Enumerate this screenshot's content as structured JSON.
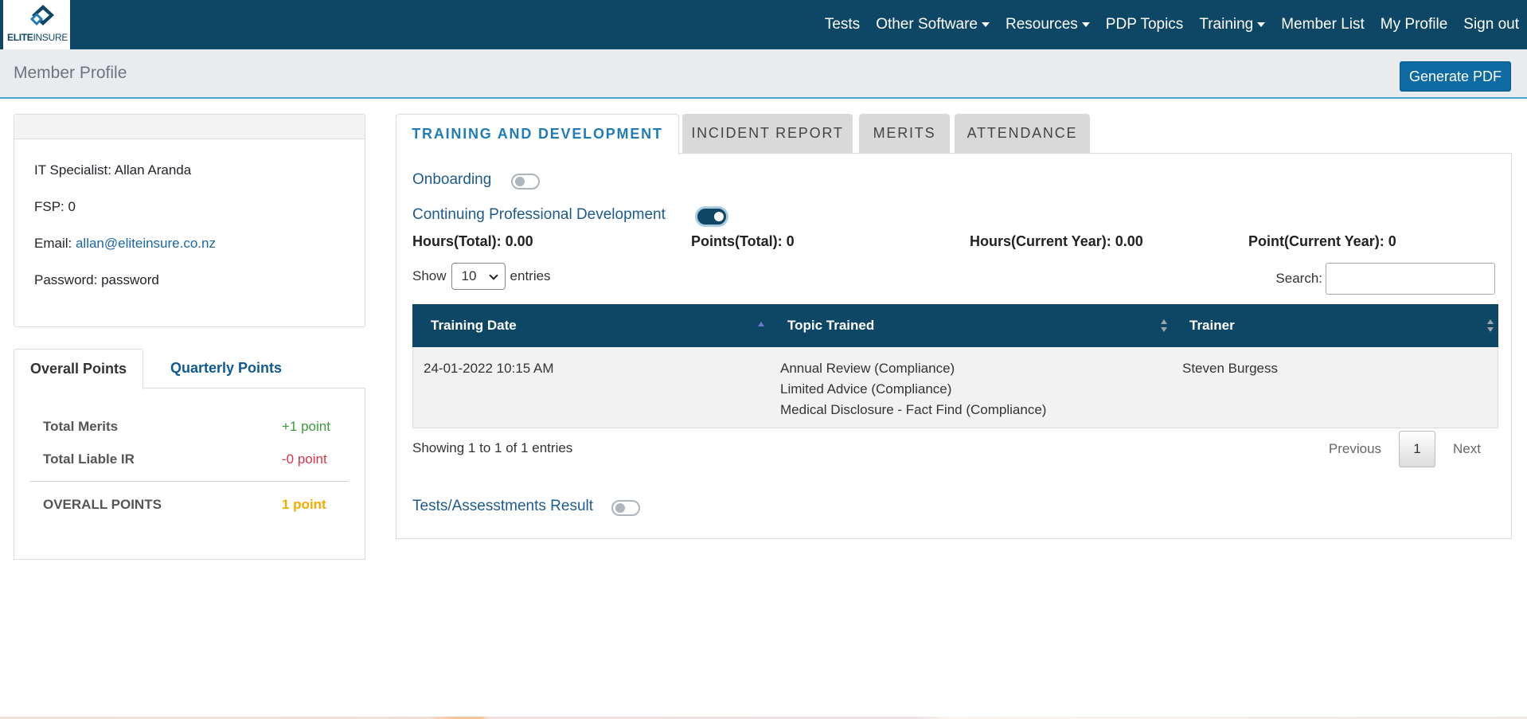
{
  "brand": {
    "logo_bold": "ELITE",
    "logo_light": "INSURE",
    "primary_color": "#0e4766",
    "accent_color": "#1f7cb8"
  },
  "nav": {
    "items": [
      {
        "label": "Tests",
        "dropdown": false
      },
      {
        "label": "Other Software",
        "dropdown": true
      },
      {
        "label": "Resources",
        "dropdown": true
      },
      {
        "label": "PDP Topics",
        "dropdown": false
      },
      {
        "label": "Training",
        "dropdown": true
      },
      {
        "label": "Member List",
        "dropdown": false
      },
      {
        "label": "My Profile",
        "dropdown": false
      },
      {
        "label": "Sign out",
        "dropdown": false
      }
    ]
  },
  "header": {
    "title": "Member Profile",
    "generate_pdf_label": "Generate PDF"
  },
  "profile": {
    "role_name": "IT Specialist: Allan Aranda",
    "fsp_label": "FSP: 0",
    "email_label": "Email: ",
    "email": "allan@eliteinsure.co.nz",
    "password_label": "Password: password"
  },
  "points": {
    "tabs": [
      "Overall Points",
      "Quarterly Points"
    ],
    "total_merits_label": "Total Merits",
    "total_merits_value": "+1 point",
    "total_liable_label": "Total Liable IR",
    "total_liable_value": "-0 point",
    "overall_label": "OVERALL POINTS",
    "overall_value": "1 point",
    "merits_color": "#3a9b3a",
    "liable_color": "#dc3545",
    "overall_color": "#f0ad00"
  },
  "tabs": [
    "TRAINING AND DEVELOPMENT",
    "INCIDENT REPORT",
    "MERITS",
    "ATTENDANCE"
  ],
  "training": {
    "onboarding_label": "Onboarding",
    "onboarding_on": false,
    "cpd_label": "Continuing Professional Development",
    "cpd_on": true,
    "stats": {
      "hours_total": "Hours(Total): 0.00",
      "points_total": "Points(Total): 0",
      "hours_current": "Hours(Current Year): 0.00",
      "points_current": "Point(Current Year): 0"
    },
    "show_label": "Show",
    "page_size": "10",
    "entries_label": "entries",
    "search_label": "Search:",
    "table": {
      "columns": [
        "Training Date",
        "Topic Trained",
        "Trainer"
      ],
      "rows": [
        {
          "date": "24-01-2022 10:15 AM",
          "topics": [
            "Annual Review (Compliance)",
            "Limited Advice (Compliance)",
            "Medical Disclosure - Fact Find (Compliance)"
          ],
          "trainer": "Steven Burgess"
        }
      ]
    },
    "showing_text": "Showing 1 to 1 of 1 entries",
    "pager": {
      "previous": "Previous",
      "page": "1",
      "next": "Next"
    },
    "tests_label": "Tests/Assesstments Result",
    "tests_on": false
  }
}
